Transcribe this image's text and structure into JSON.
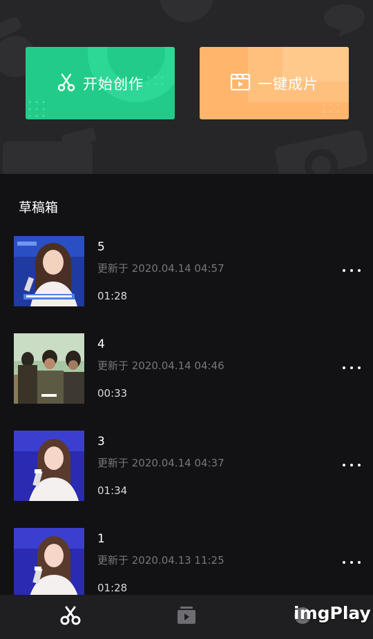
{
  "actions": {
    "create_label": "开始创作",
    "oneclick_label": "一键成片",
    "create_icon": "scissors-icon",
    "oneclick_icon": "clapperboard-icon",
    "create_color": "#22cc88",
    "oneclick_color": "#ffb56b"
  },
  "drafts": {
    "title": "草稿箱",
    "items": [
      {
        "name": "5",
        "updated": "更新于 2020.04.14 04:57",
        "duration": "01:28",
        "thumb": "stage-interview"
      },
      {
        "name": "4",
        "updated": "更新于 2020.04.14 04:46",
        "duration": "00:33",
        "thumb": "desert-scene"
      },
      {
        "name": "3",
        "updated": "更新于 2020.04.14 04:37",
        "duration": "01:34",
        "thumb": "stage-interview"
      },
      {
        "name": "1",
        "updated": "更新于 2020.04.13 11:25",
        "duration": "01:28",
        "thumb": "stage-interview"
      }
    ]
  },
  "nav": {
    "items": [
      {
        "icon": "scissors-icon",
        "active": true
      },
      {
        "icon": "template-icon",
        "active": false
      },
      {
        "icon": "profile-icon",
        "active": false
      }
    ]
  },
  "watermark": "imgPlay"
}
